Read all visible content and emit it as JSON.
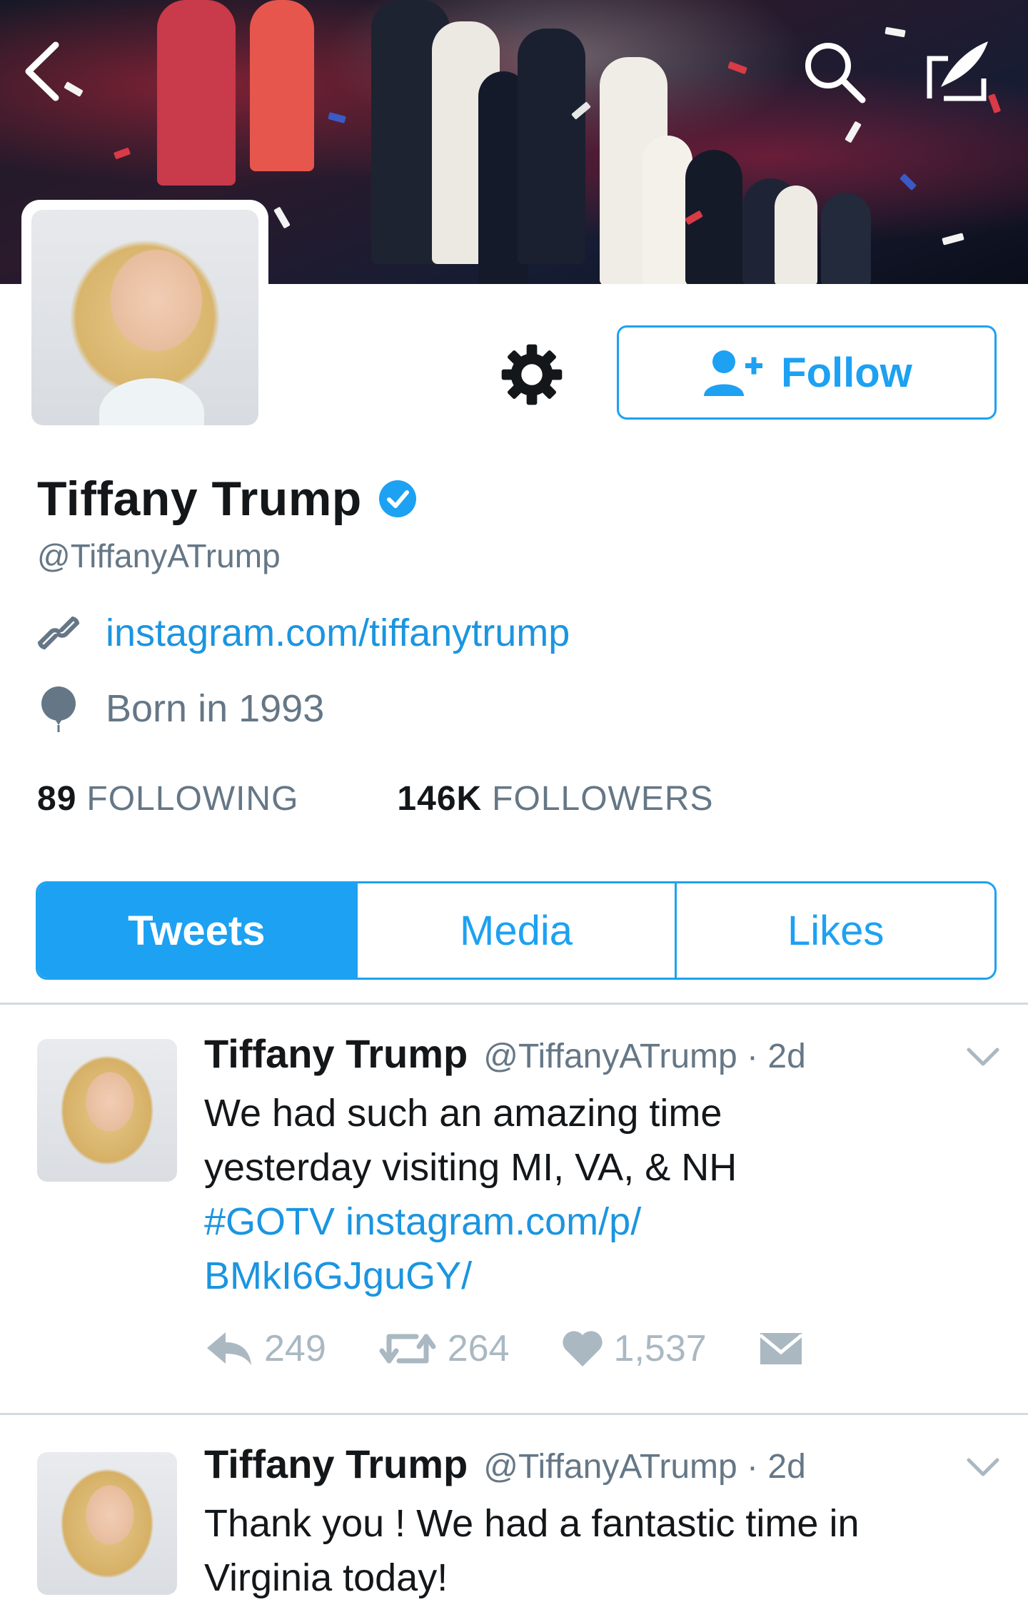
{
  "header": {
    "back_icon": "back-arrow-icon",
    "search_icon": "search-icon",
    "compose_icon": "compose-tweet-icon"
  },
  "profile": {
    "name": "Tiffany Trump",
    "verified": true,
    "handle": "@TiffanyATrump",
    "website": "instagram.com/tiffanytrump",
    "birth": "Born in 1993",
    "follow_label": "Follow",
    "following_count": "89",
    "following_label": "FOLLOWING",
    "followers_count": "146K",
    "followers_label": "FOLLOWERS"
  },
  "tabs": [
    {
      "label": "Tweets",
      "active": true
    },
    {
      "label": "Media",
      "active": false
    },
    {
      "label": "Likes",
      "active": false
    }
  ],
  "tweets": [
    {
      "name": "Tiffany Trump",
      "handle_time": "@TiffanyATrump · 2d",
      "text_lines": [
        "We had such an amazing time",
        "yesterday visiting MI, VA, & NH"
      ],
      "link_lines": [
        "#GOTV instagram.com/p/",
        "BMkI6GJguGY/"
      ],
      "replies": "249",
      "retweets": "264",
      "likes": "1,537"
    },
    {
      "name": "Tiffany Trump",
      "handle_time": "@TiffanyATrump · 2d",
      "text_lines": [
        "Thank you ! We had a fantastic time in",
        "Virginia today!"
      ]
    }
  ],
  "colors": {
    "accent": "#1da1f2",
    "link": "#1b95e0",
    "muted": "#657786",
    "action_gray": "#aab8c2"
  }
}
